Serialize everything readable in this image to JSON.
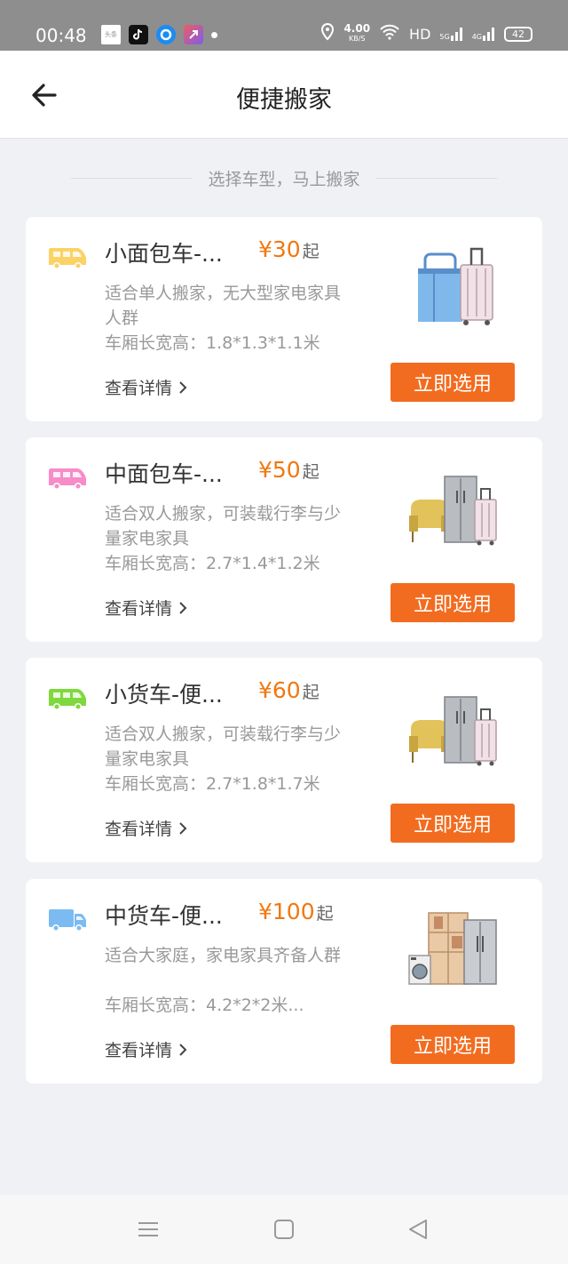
{
  "status_bar": {
    "time": "00:48",
    "app_icons": [
      "toutiao-icon",
      "tiktok-icon",
      "browser-icon",
      "app-icon"
    ],
    "speed_value": "4.00",
    "speed_unit": "KB/S",
    "hd": "HD",
    "net1": "5G",
    "net2": "4G",
    "battery": "42"
  },
  "header": {
    "title": "便捷搬家"
  },
  "section_label": "选择车型，马上搬家",
  "vehicles": [
    {
      "name": "小面包车-...",
      "price": "¥30",
      "price_suffix": "起",
      "desc": "适合单人搬家，无大型家电家具人群",
      "dims": "车厢长宽高：1.8*1.3*1.1米",
      "details": "查看详情",
      "button": "立即选用",
      "van_color": "#fbd266",
      "illustration": "luggage-illustration"
    },
    {
      "name": "中面包车-...",
      "price": "¥50",
      "price_suffix": "起",
      "desc": "适合双人搬家，可装载行李与少量家电家具",
      "dims": "车厢长宽高：2.7*1.4*1.2米",
      "details": "查看详情",
      "button": "立即选用",
      "van_color": "#f78cc9",
      "illustration": "furniture-illustration"
    },
    {
      "name": "小货车-便...",
      "price": "¥60",
      "price_suffix": "起",
      "desc": "适合双人搬家，可装载行李与少量家电家具",
      "dims": "车厢长宽高：2.7*1.8*1.7米",
      "details": "查看详情",
      "button": "立即选用",
      "van_color": "#7fd93e",
      "illustration": "furniture-illustration"
    },
    {
      "name": "中货车-便...",
      "price": "¥100",
      "price_suffix": "起",
      "desc": "适合大家庭，家电家具齐备人群",
      "dims": "车厢长宽高：4.2*2*2米...",
      "details": "查看详情",
      "button": "立即选用",
      "van_color": "#7bbbf2",
      "illustration": "appliances-illustration"
    }
  ],
  "colors": {
    "accent": "#f26c20",
    "price": "#f0780f",
    "background": "#f0f1f5"
  }
}
